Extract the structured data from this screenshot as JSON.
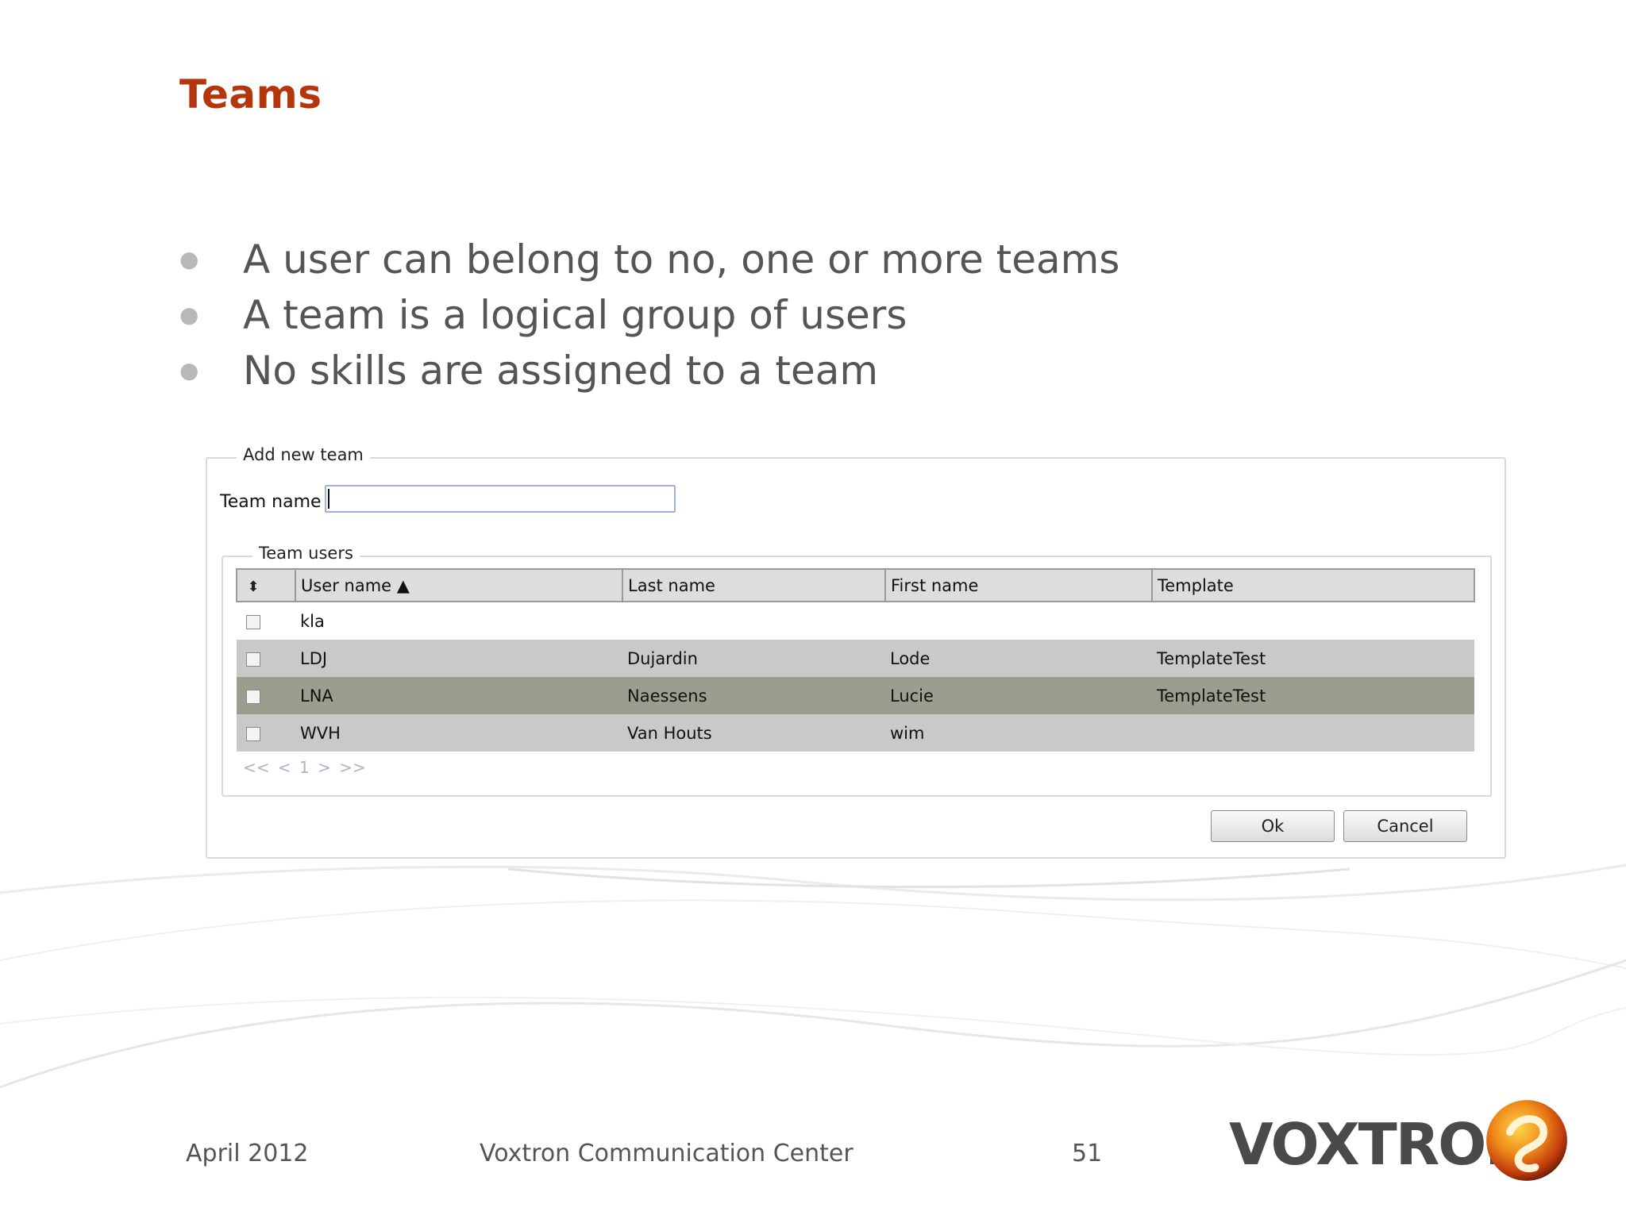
{
  "slide": {
    "title": "Teams",
    "bullets": [
      "A user can belong to no, one or more teams",
      "A team is a logical group of users",
      "No skills are assigned to a team"
    ]
  },
  "dialog": {
    "legend": "Add new team",
    "team_name_label": "Team name",
    "team_name_value": "",
    "team_users": {
      "legend": "Team users",
      "columns": [
        "User name ▲",
        "Last name",
        "First name",
        "Template"
      ],
      "rows": [
        {
          "user": "kla",
          "last": "",
          "first": "",
          "template": ""
        },
        {
          "user": "LDJ",
          "last": "Dujardin",
          "first": "Lode",
          "template": "TemplateTest"
        },
        {
          "user": "LNA",
          "last": "Naessens",
          "first": "Lucie",
          "template": "TemplateTest"
        },
        {
          "user": "WVH",
          "last": "Van Houts",
          "first": "wim",
          "template": ""
        }
      ],
      "pager": "<< < 1 > >>"
    },
    "ok_label": "Ok",
    "cancel_label": "Cancel"
  },
  "footer": {
    "date": "April 2012",
    "center": "Voxtron Communication Center",
    "page": "51",
    "logo_text": "VOXTRON"
  },
  "colors": {
    "title": "#b5360d",
    "bullet_text": "#555555",
    "selected_row": "#9c9d8f",
    "alt_row": "#c9c9c9"
  }
}
